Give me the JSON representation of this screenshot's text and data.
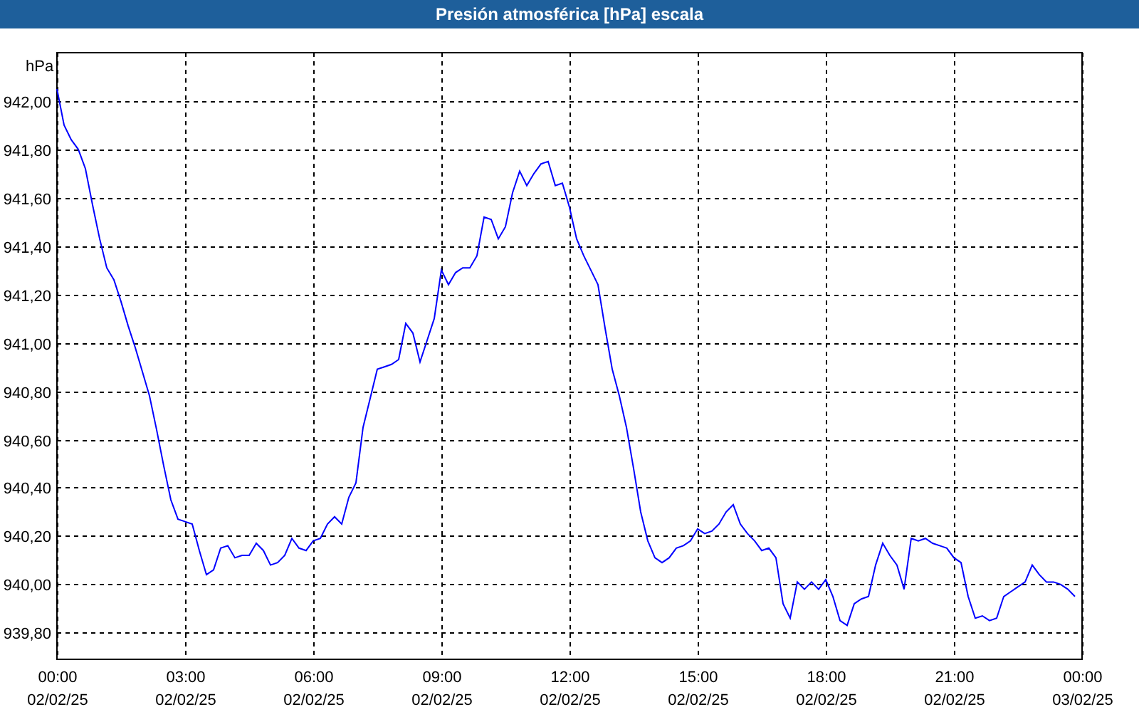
{
  "window": {
    "title": "Presión atmosférica [hPa] escala"
  },
  "chart_data": {
    "type": "line",
    "ylabel": "hPa",
    "grid": true,
    "ylim": [
      939.69,
      942.2
    ],
    "yticks": [
      {
        "value": 939.8,
        "label": "939,80"
      },
      {
        "value": 940,
        "label": "940,00"
      },
      {
        "value": 940.2,
        "label": "940,20"
      },
      {
        "value": 940.4,
        "label": "940,40"
      },
      {
        "value": 940.6,
        "label": "940,60"
      },
      {
        "value": 940.8,
        "label": "940,80"
      },
      {
        "value": 941,
        "label": "941,00"
      },
      {
        "value": 941.2,
        "label": "941,20"
      },
      {
        "value": 941.4,
        "label": "941,40"
      },
      {
        "value": 941.6,
        "label": "941,60"
      },
      {
        "value": 941.8,
        "label": "941,80"
      },
      {
        "value": 942,
        "label": "942,00"
      }
    ],
    "categories": [
      "00:00\n02/02/25",
      null,
      null,
      null,
      null,
      null,
      null,
      null,
      null,
      null,
      null,
      null,
      null,
      null,
      null,
      null,
      null,
      null,
      "03:00\n02/02/25",
      null,
      null,
      null,
      null,
      null,
      null,
      null,
      null,
      null,
      null,
      null,
      null,
      null,
      null,
      null,
      null,
      null,
      "06:00\n02/02/25",
      null,
      null,
      null,
      null,
      null,
      null,
      null,
      null,
      null,
      null,
      null,
      null,
      null,
      null,
      null,
      null,
      null,
      "09:00\n02/02/25",
      null,
      null,
      null,
      null,
      null,
      null,
      null,
      null,
      null,
      null,
      null,
      null,
      null,
      null,
      null,
      null,
      null,
      "12:00\n02/02/25",
      null,
      null,
      null,
      null,
      null,
      null,
      null,
      null,
      null,
      null,
      null,
      null,
      null,
      null,
      null,
      null,
      null,
      "15:00\n02/02/25",
      null,
      null,
      null,
      null,
      null,
      null,
      null,
      null,
      null,
      null,
      null,
      null,
      null,
      null,
      null,
      null,
      null,
      "18:00\n02/02/25",
      null,
      null,
      null,
      null,
      null,
      null,
      null,
      null,
      null,
      null,
      null,
      null,
      null,
      null,
      null,
      null,
      null,
      "21:00\n02/02/25",
      null,
      null,
      null,
      null,
      null,
      null,
      null,
      null,
      null,
      null,
      null,
      null,
      null,
      null,
      null,
      null,
      null,
      "00:00\n03/02/25"
    ],
    "series": [
      {
        "color": "#0000ff",
        "values": [
          942.05,
          941.9,
          941.84,
          941.8,
          941.72,
          941.57,
          941.43,
          941.31,
          941.26,
          941.17,
          941.07,
          940.98,
          940.88,
          940.78,
          940.64,
          940.49,
          940.35,
          940.27,
          940.26,
          940.25,
          940.14,
          940.04,
          940.06,
          940.15,
          940.16,
          940.11,
          940.12,
          940.12,
          940.17,
          940.14,
          940.08,
          940.09,
          940.12,
          940.19,
          940.15,
          940.14,
          940.18,
          940.19,
          940.25,
          940.28,
          940.25,
          940.36,
          940.42,
          940.65,
          940.77,
          940.89,
          940.9,
          940.91,
          940.93,
          941.08,
          941.04,
          940.92,
          941.01,
          941.1,
          941.3,
          941.24,
          941.29,
          941.31,
          941.31,
          941.36,
          941.52,
          941.51,
          941.43,
          941.48,
          941.62,
          941.71,
          941.65,
          941.7,
          941.74,
          941.75,
          941.65,
          941.66,
          941.56,
          941.43,
          941.36,
          941.3,
          941.24,
          941.06,
          940.89,
          940.78,
          940.65,
          940.48,
          940.3,
          940.18,
          940.11,
          940.09,
          940.11,
          940.15,
          940.16,
          940.18,
          940.23,
          940.21,
          940.22,
          940.25,
          940.3,
          940.33,
          940.25,
          940.21,
          940.18,
          940.14,
          940.15,
          940.11,
          939.92,
          939.86,
          940.01,
          939.98,
          940.01,
          939.98,
          940.02,
          939.95,
          939.85,
          939.83,
          939.92,
          939.94,
          939.95,
          940.08,
          940.17,
          940.12,
          940.08,
          939.98,
          940.19,
          940.18,
          940.19,
          940.17,
          940.16,
          940.15,
          940.11,
          940.09,
          939.95,
          939.86,
          939.87,
          939.85,
          939.86,
          939.95,
          939.97,
          939.99,
          940.01,
          940.08,
          940.04,
          940.01,
          940.01,
          940.0,
          939.98,
          939.95,
          null
        ]
      }
    ]
  }
}
